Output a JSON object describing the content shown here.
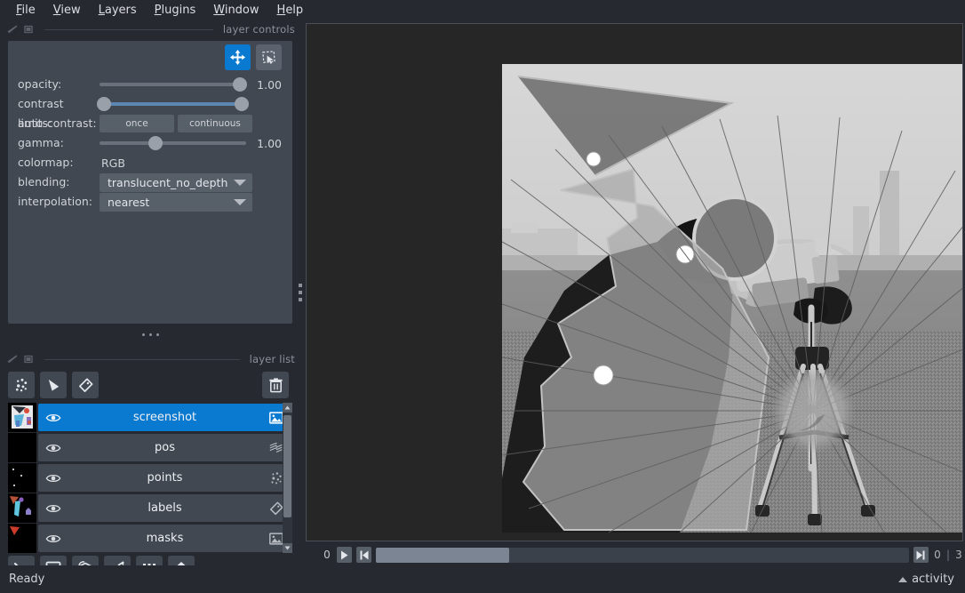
{
  "menubar": {
    "items": [
      {
        "label": "File",
        "accel": "F"
      },
      {
        "label": "View",
        "accel": "V"
      },
      {
        "label": "Layers",
        "accel": "L"
      },
      {
        "label": "Plugins",
        "accel": "P"
      },
      {
        "label": "Window",
        "accel": "W"
      },
      {
        "label": "Help",
        "accel": "H"
      }
    ]
  },
  "layer_controls": {
    "dock_title": "layer controls",
    "modes": [
      {
        "name": "pan-zoom",
        "icon": "move-arrows-icon",
        "active": true
      },
      {
        "name": "transform",
        "icon": "transform-select-icon",
        "active": false
      }
    ],
    "opacity": {
      "label": "opacity:",
      "value": "1.00",
      "handle_pct": 96
    },
    "contrast_limits": {
      "label": "contrast limits:",
      "low_pct": 2,
      "high_pct": 98
    },
    "auto_contrast": {
      "label": "auto-contrast:",
      "once": "once",
      "continuous": "continuous"
    },
    "gamma": {
      "label": "gamma:",
      "value": "1.00",
      "handle_pct": 38
    },
    "colormap": {
      "label": "colormap:",
      "value": "RGB"
    },
    "blending": {
      "label": "blending:",
      "value": "translucent_no_depth"
    },
    "interpolation": {
      "label": "interpolation:",
      "value": "nearest"
    }
  },
  "layer_list": {
    "dock_title": "layer list",
    "toolbar": [
      {
        "name": "new-points-layer",
        "icon": "points-icon"
      },
      {
        "name": "new-shapes-layer",
        "icon": "shapes-icon"
      },
      {
        "name": "new-labels-layer",
        "icon": "labels-tag-icon"
      },
      {
        "name": "delete-layer",
        "icon": "trash-icon"
      }
    ],
    "layers": [
      {
        "name": "screenshot",
        "type_icon": "image-icon",
        "visible": true,
        "selected": true
      },
      {
        "name": "pos",
        "type_icon": "vectors-icon",
        "visible": true,
        "selected": false
      },
      {
        "name": "points",
        "type_icon": "points-icon",
        "visible": true,
        "selected": false
      },
      {
        "name": "labels",
        "type_icon": "labels-tag-icon",
        "visible": true,
        "selected": false
      },
      {
        "name": "masks",
        "type_icon": "image-icon",
        "visible": true,
        "selected": false
      }
    ]
  },
  "bottom_tools": [
    {
      "name": "console-button",
      "icon": "terminal-icon"
    },
    {
      "name": "toggle-2d-3d-button",
      "icon": "square-2d-icon"
    },
    {
      "name": "roll-dimensions-button",
      "icon": "cube-3d-icon"
    },
    {
      "name": "transpose-dimensions-button",
      "icon": "transpose-icon"
    },
    {
      "name": "grid-view-button",
      "icon": "grid-icon"
    },
    {
      "name": "reset-view-button",
      "icon": "home-icon"
    }
  ],
  "dims": {
    "axis_label": "0",
    "play_icon": "play-icon",
    "first_frame_icon": "step-first-icon",
    "last_frame_icon": "step-last-icon",
    "slider_value": "0",
    "max_value": "3",
    "separator": "|",
    "thumb_pct": 23
  },
  "statusbar": {
    "status": "Ready",
    "activity_label": "activity",
    "activity_icon": "caret-up-icon"
  },
  "colors": {
    "accent": "#0a7ad1",
    "panel": "#414851",
    "window_bg": "#262930",
    "canvas_bg": "#262626",
    "text": "#d0d3d8",
    "muted_text": "#8c9099",
    "slider_handle": "#9aa0aa",
    "contrast_fill": "#5d87b3"
  }
}
